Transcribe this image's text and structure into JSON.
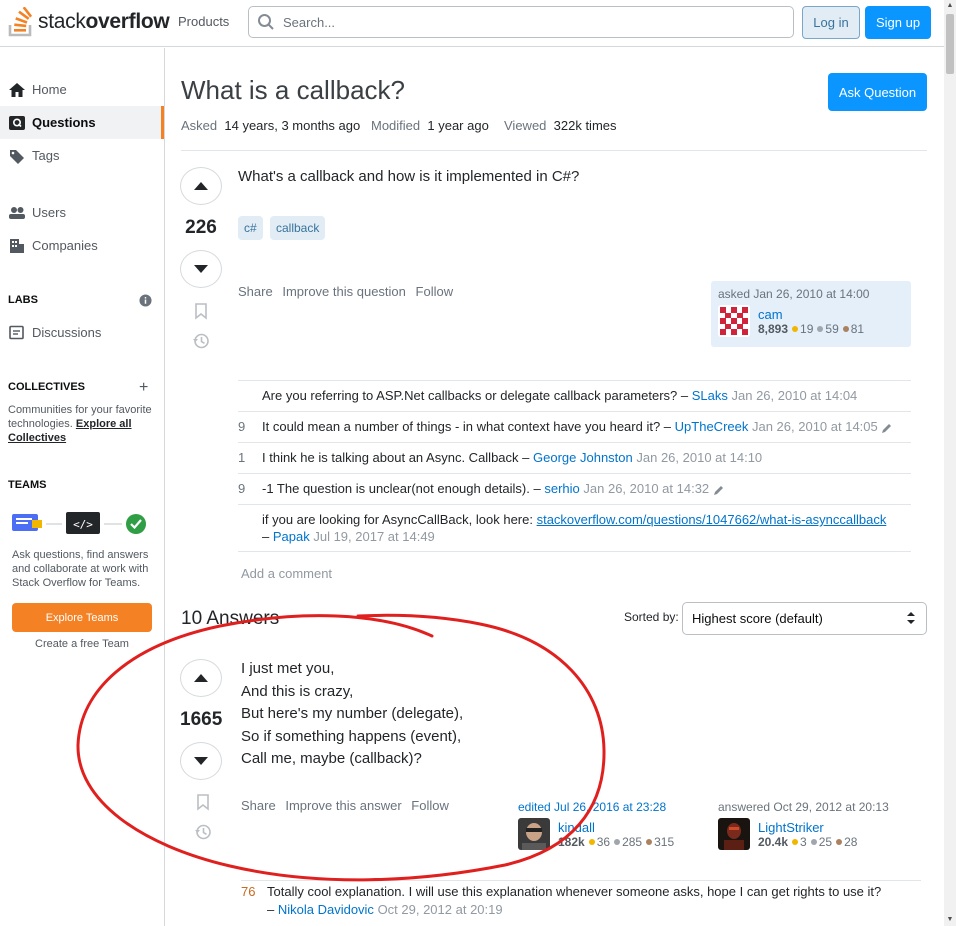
{
  "header": {
    "logo_text_regular": "stack",
    "logo_text_bold": "overflow",
    "products_label": "Products",
    "search_placeholder": "Search...",
    "login_label": "Log in",
    "signup_label": "Sign up"
  },
  "sidebar": {
    "items": [
      {
        "label": "Home",
        "icon": "home-icon"
      },
      {
        "label": "Questions",
        "icon": "questions-icon",
        "active": true
      },
      {
        "label": "Tags",
        "icon": "tag-icon"
      },
      {
        "label": "Users",
        "icon": "users-icon"
      },
      {
        "label": "Companies",
        "icon": "companies-icon"
      }
    ],
    "labs_heading": "LABS",
    "discussions_label": "Discussions",
    "collectives_heading": "COLLECTIVES",
    "collectives_text": "Communities for your favorite technologies.",
    "collectives_link": "Explore all Collectives",
    "teams_heading": "TEAMS",
    "teams_text": "Ask questions, find answers and collaborate at work with Stack Overflow for Teams.",
    "explore_teams_label": "Explore Teams",
    "create_team_label": "Create a free Team"
  },
  "question": {
    "title": "What is a callback?",
    "ask_button": "Ask Question",
    "asked_label": "Asked",
    "asked_value": "14 years, 3 months ago",
    "modified_label": "Modified",
    "modified_value": "1 year ago",
    "viewed_label": "Viewed",
    "viewed_value": "322k times",
    "score": "226",
    "body": "What's a callback and how is it implemented in C#?",
    "tags": [
      "c#",
      "callback"
    ],
    "menu": [
      "Share",
      "Improve this question",
      "Follow"
    ],
    "owner": {
      "time": "asked Jan 26, 2010 at 14:00",
      "name": "cam",
      "rep": "8,893",
      "gold": "19",
      "silver": "59",
      "bronze": "81"
    },
    "comments": [
      {
        "score": "",
        "text": "Are you referring to ASP.Net callbacks or delegate callback parameters? –",
        "user": "SLaks",
        "date": "Jan 26, 2010 at 14:04",
        "edited": false
      },
      {
        "score": "9",
        "text": "It could mean a number of things - in what context have you heard it? –",
        "user": "UpTheCreek",
        "date": "Jan 26, 2010 at 14:05",
        "edited": true
      },
      {
        "score": "1",
        "text": "I think he is talking about an Async. Callback –",
        "user": "George Johnston",
        "date": "Jan 26, 2010 at 14:10",
        "edited": false
      },
      {
        "score": "9",
        "text": "-1 The question is unclear(not enough details). –",
        "user": "serhio",
        "date": "Jan 26, 2010 at 14:32",
        "edited": true
      },
      {
        "score": "",
        "text": "if you are looking for AsyncCallBack, look here:",
        "link": "stackoverflow.com/questions/1047662/what-is-asynccallback",
        "user": "Papak",
        "date": "Jul 19, 2017 at 14:49",
        "edited": false
      }
    ],
    "add_comment": "Add a comment"
  },
  "answers": {
    "count_label": "10 Answers",
    "sorted_by_label": "Sorted by:",
    "sort_value": "Highest score (default)",
    "top": {
      "score": "1665",
      "lines": [
        "I just met you,",
        "And this is crazy,",
        "But here's my number (delegate),",
        "So if something happens (event),",
        "Call me, maybe (callback)?"
      ],
      "menu": [
        "Share",
        "Improve this answer",
        "Follow"
      ],
      "editor": {
        "time": "edited Jul 26, 2016 at 23:28",
        "name": "kindall",
        "rep": "182k",
        "gold": "36",
        "silver": "285",
        "bronze": "315"
      },
      "author": {
        "time": "answered Oct 29, 2012 at 20:13",
        "name": "LightStriker",
        "rep": "20.4k",
        "gold": "3",
        "silver": "25",
        "bronze": "28"
      },
      "comment": {
        "score": "76",
        "text": "Totally cool explanation. I will use this explanation whenever someone asks, hope I can get rights to use it?",
        "user": "Nikola Davidovic",
        "date": "Oct 29, 2012 at 20:19"
      }
    }
  },
  "colors": {
    "brand_orange": "#f48225",
    "primary_blue": "#0a95ff",
    "annotation_red": "#e0201f"
  }
}
